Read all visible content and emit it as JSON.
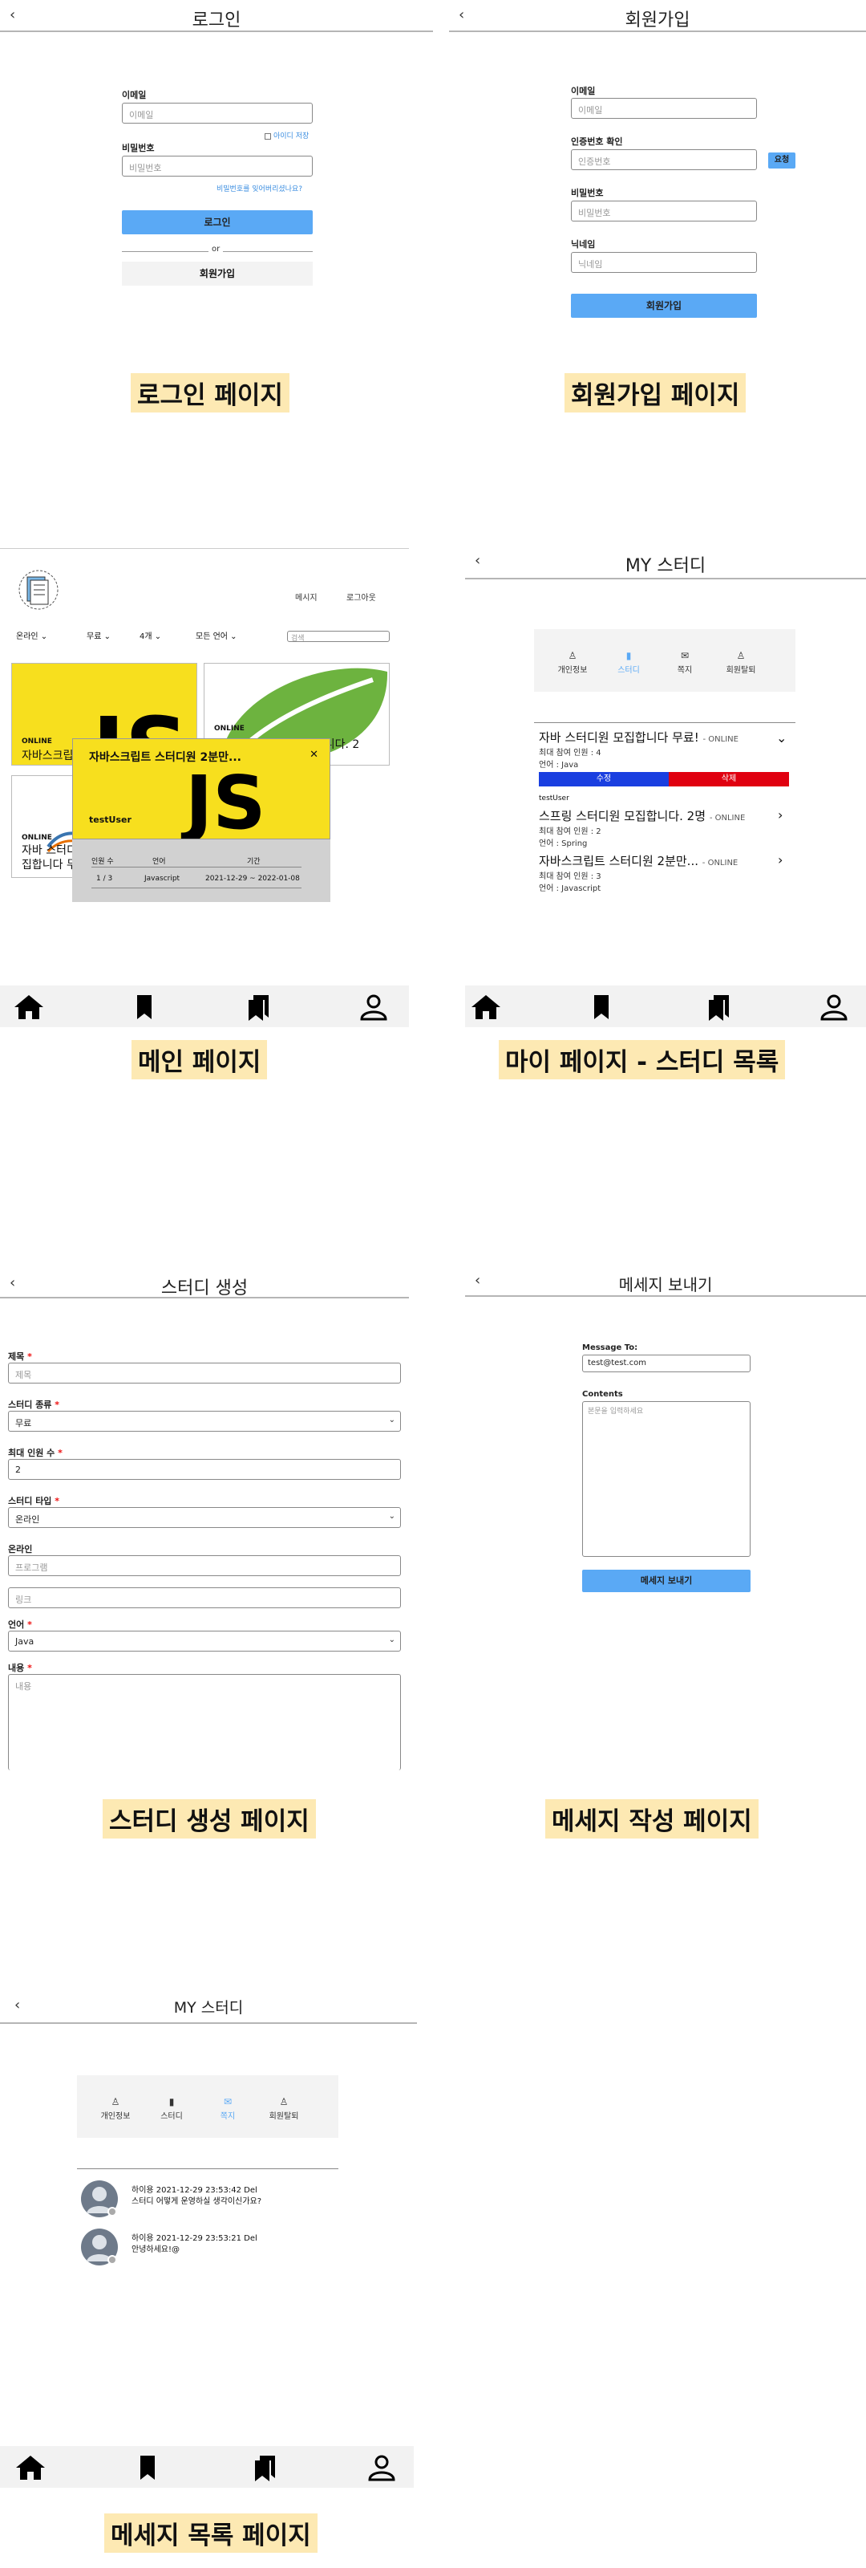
{
  "captions": {
    "login": "로그인 페이지",
    "signup": "회원가입 페이지",
    "main": "메인 페이지",
    "mypage": "마이 페이지 - 스터디 목록",
    "create": "스터디 생성 페이지",
    "message_write": "메세지 작성 페이지",
    "message_list": "메세지 목록 페이지"
  },
  "back_glyph": "‹",
  "login": {
    "title": "로그인",
    "email_label": "이메일",
    "email_placeholder": "이메일",
    "save_id": "아이디 저장",
    "password_label": "비밀번호",
    "password_placeholder": "비밀번호",
    "forgot": "비밀번호를 잊어버리셨나요?",
    "login_button": "로그인",
    "or": "or",
    "signup_button": "회원가입"
  },
  "signup": {
    "title": "회원가입",
    "email_label": "이메일",
    "email_placeholder": "이메일",
    "verify_label": "인증번호 확인",
    "verify_placeholder": "인증번호",
    "request_button": "요청",
    "password_label": "비밀번호",
    "password_placeholder": "비밀번호",
    "nickname_label": "닉네임",
    "nickname_placeholder": "닉네임",
    "submit_button": "회원가입"
  },
  "main": {
    "nav_message": "메시지",
    "nav_logout": "로그아웃",
    "filters": [
      "온라인",
      "무료",
      "4개",
      "모든 언어"
    ],
    "search_placeholder": "검색",
    "cards": [
      {
        "badge": "ONLINE",
        "title": "자바스크립트 스터디원 2분만..."
      },
      {
        "badge": "ONLINE",
        "title": "스프링 스터디원 모집합니다. 2"
      },
      {
        "badge": "ONLINE",
        "title": "자바 스터디원 모집합니다 무료!"
      }
    ],
    "modal": {
      "title": "자바스크립트 스터디원 2분만...",
      "close": "✕",
      "user": "testUser",
      "cols": [
        "인원 수",
        "언어",
        "기간"
      ],
      "vals": [
        "1 / 3",
        "Javascript",
        "2021-12-29 ~ 2022-01-08"
      ]
    }
  },
  "mypage": {
    "title": "MY 스터디",
    "menu": [
      "개인정보",
      "스터디",
      "쪽지",
      "회원탈퇴"
    ],
    "studies": [
      {
        "title": "자바 스터디원 모집합니다 무료!",
        "mode": "- ONLINE",
        "max": "최대 참여 인원 : 4",
        "lang": "언어 : Java"
      },
      {
        "title": "스프링 스터디원 모집합니다. 2명",
        "mode": "- ONLINE",
        "max": "최대 참여 인원 : 2",
        "lang": "언어 : Spring"
      },
      {
        "title": "자바스크립트 스터디원 2분만...",
        "mode": "- ONLINE",
        "max": "최대 참여 인원 : 3",
        "lang": "언어 : Javascript"
      }
    ],
    "edit": "수정",
    "delete": "삭제",
    "member": "testUser"
  },
  "create": {
    "title": "스터디 생성",
    "title_label": "제목",
    "title_placeholder": "제목",
    "kind_label": "스터디 종류",
    "kind_value": "무료",
    "max_label": "최대 인원 수",
    "max_value": "2",
    "type_label": "스터디 타입",
    "type_value": "온라인",
    "online_label": "온라인",
    "program_placeholder": "프로그램",
    "link_placeholder": "링크",
    "lang_label": "언어",
    "lang_value": "Java",
    "content_label": "내용",
    "content_placeholder": "내용"
  },
  "message": {
    "title": "메세지 보내기",
    "to_label": "Message To:",
    "to_value": "test@test.com",
    "contents_label": "Contents",
    "contents_placeholder": "본문을 입력하세요",
    "send_button": "메세지 보내기"
  },
  "msglist": {
    "title": "MY 스터디",
    "menu": [
      "개인정보",
      "스터디",
      "쪽지",
      "회원탈퇴"
    ],
    "messages": [
      {
        "meta": "하이용 2021-12-29 23:53:42 Del",
        "text": "스터디 어떻게 운영하실 생각이신가요?"
      },
      {
        "meta": "하이용 2021-12-29 23:53:21 Del",
        "text": "안녕하세요!@"
      }
    ]
  },
  "colors": {
    "accent": "#5aa9f5",
    "js_yellow": "#f7df1e",
    "edit_blue": "#1a3fe0",
    "delete_red": "#e00010",
    "caption_bg": "#fde9b3"
  }
}
